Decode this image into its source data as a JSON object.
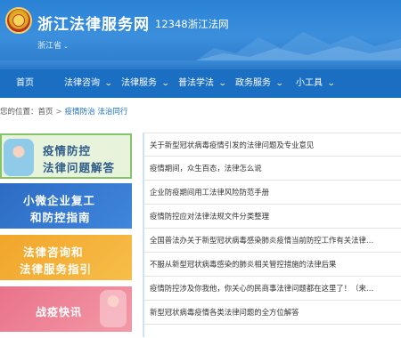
{
  "header": {
    "site_name": "浙江法律服务网",
    "phone": "12348浙江法网",
    "region": "浙江省",
    "region_caret": "⌄"
  },
  "nav": {
    "items": [
      {
        "label": "首页",
        "has_arrow": false
      },
      {
        "label": "法律咨询",
        "has_arrow": true
      },
      {
        "label": "法律服务",
        "has_arrow": true
      },
      {
        "label": "普法学法",
        "has_arrow": true
      },
      {
        "label": "政务服务",
        "has_arrow": true
      },
      {
        "label": "小工具",
        "has_arrow": true
      }
    ],
    "arrow": "⌄"
  },
  "breadcrumb": {
    "prefix": "您的位置：",
    "home": "首页",
    "separator": ">",
    "current": "疫情防治 法治同行"
  },
  "banners": [
    {
      "line1": "疫情防控",
      "line2": "法律问题解答"
    },
    {
      "line1": "小微企业复工",
      "line2": "和防控指南"
    },
    {
      "line1": "法律咨询和",
      "line2": "法律服务指引"
    },
    {
      "line1": "战疫快讯",
      "line2": ""
    }
  ],
  "articles": [
    "关于新型冠状病毒疫情引发的法律问题及专业意见",
    "疫情期间，众生百态，法律怎么说",
    "企业防疫期间用工法律风险防范手册",
    "疫情防控应对法律法规文件分类整理",
    "全国普法办关于新型冠状病毒感染肺炎疫情当前防控工作有关法律…",
    "不服从新型冠状病毒感染的肺炎相关管控措施的法律后果",
    "疫情防控涉及你我他，你关心的民商事法律问题都在这里了！（来…",
    "新型冠状病毒疫情各类法律问题的全方位解答"
  ],
  "colors": {
    "header_blue": "#2a82d6",
    "nav_blue": "#1b6fc3",
    "banner_green_border": "#86c36a",
    "banner_blue": "#2d6cc4",
    "banner_orange": "#f2a52a",
    "banner_pink": "#e9728a",
    "link_blue": "#1b6fc3"
  }
}
